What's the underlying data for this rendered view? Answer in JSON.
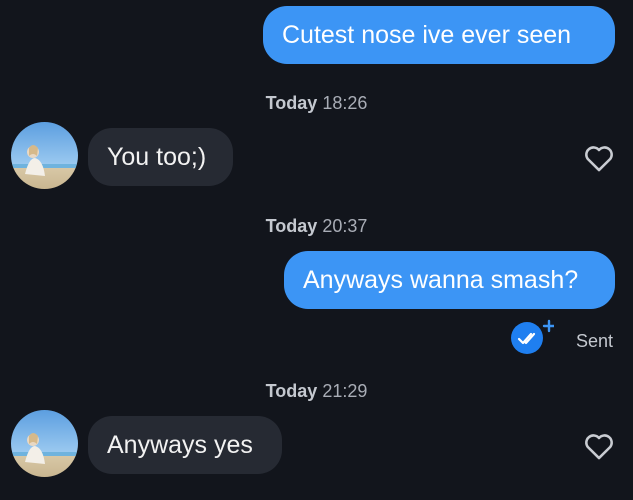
{
  "messages": [
    {
      "direction": "outgoing",
      "text": "Cutest nose ive ever seen"
    },
    {
      "direction": "incoming",
      "text": "You too;)"
    },
    {
      "direction": "outgoing",
      "text": "Anyways wanna smash?"
    },
    {
      "direction": "incoming",
      "text": "Anyways yes"
    }
  ],
  "timestamps": [
    {
      "day": "Today",
      "time": "18:26"
    },
    {
      "day": "Today",
      "time": "20:37"
    },
    {
      "day": "Today",
      "time": "21:29"
    }
  ],
  "status": {
    "label": "Sent"
  },
  "icons": {
    "like": "heart-outline-icon",
    "receipt": "double-check-icon",
    "avatar": "avatar-photo"
  },
  "colors": {
    "background": "#12151c",
    "outgoing_bubble": "#3c95f5",
    "incoming_bubble": "#262a33",
    "receipt_badge": "#1f7ff0"
  }
}
